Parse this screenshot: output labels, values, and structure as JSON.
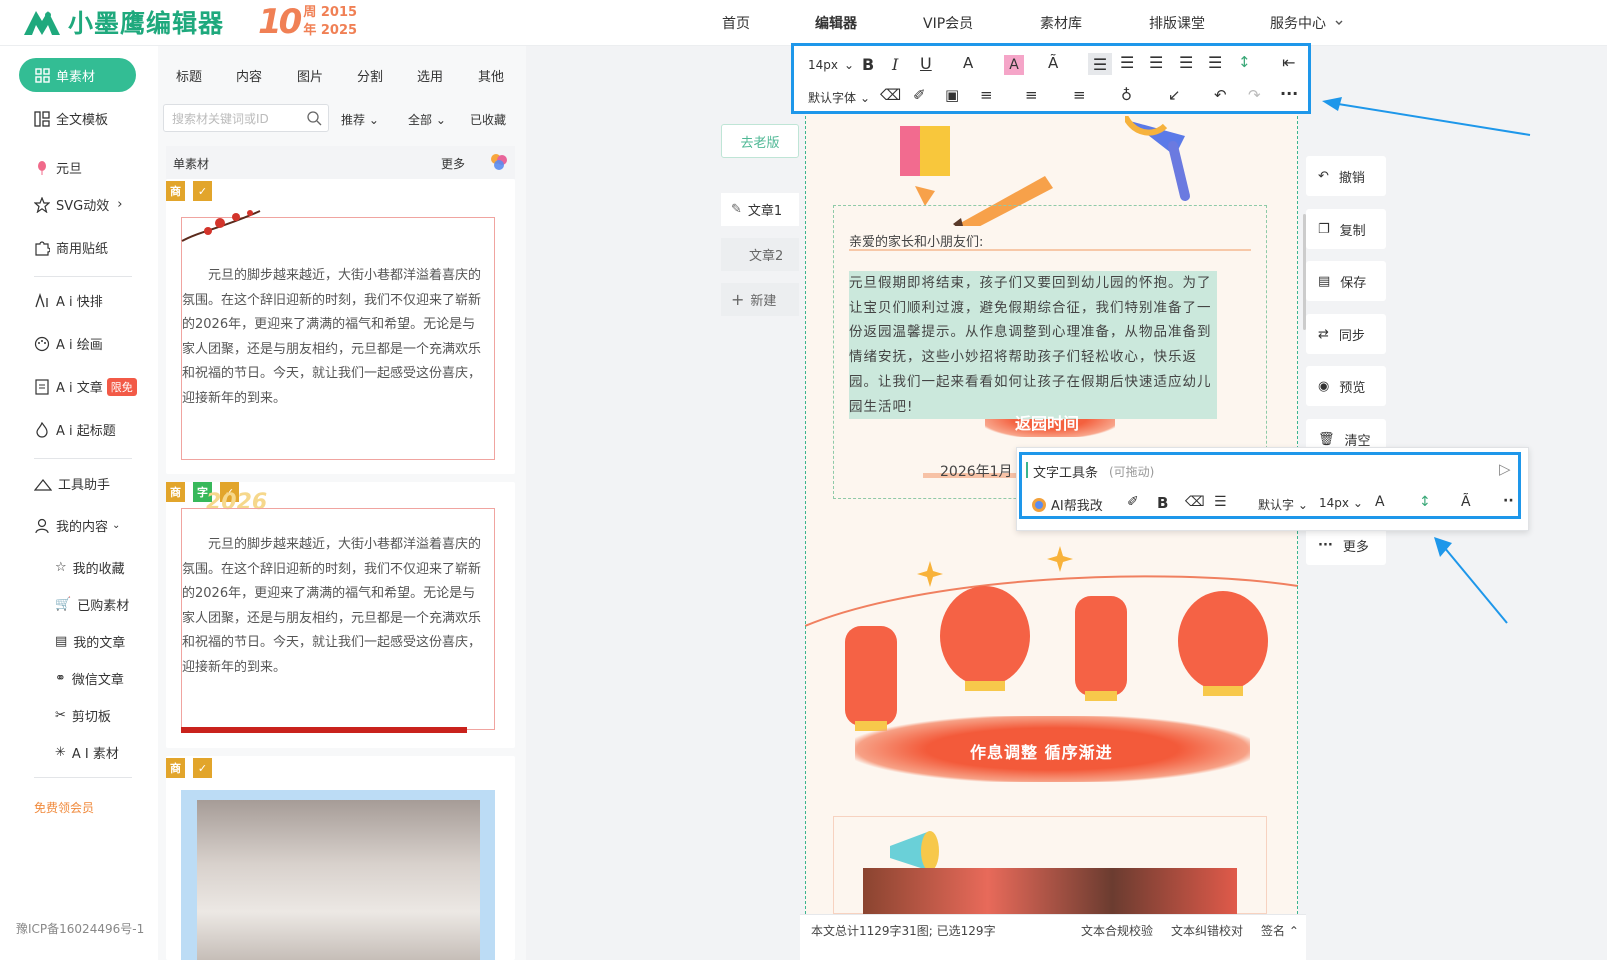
{
  "header": {
    "logo_text": "小墨鹰编辑器",
    "anniversary_number": "10",
    "anniversary_line1": "周 2015",
    "anniversary_line2": "年 2025",
    "nav": [
      "首页",
      "编辑器",
      "VIP会员",
      "素材库",
      "排版课堂",
      "服务中心"
    ]
  },
  "leftnav": {
    "active": "单素材",
    "items": [
      "全文模板",
      "元旦",
      "SVG动效",
      "商用贴纸",
      "A i 快排",
      "A i 绘画",
      "A i 文章",
      "A i 起标题",
      "工具助手",
      "我的内容"
    ],
    "ai_article_badge": "限免",
    "my_content": [
      "我的收藏",
      "已购素材",
      "我的文章",
      "微信文章",
      "剪切板",
      "A I 素材"
    ],
    "promo": "免费领会员",
    "icp": "豫ICP备16024496号-1"
  },
  "panel": {
    "tabs": [
      "标题",
      "内容",
      "图片",
      "分割",
      "选用",
      "其他"
    ],
    "search_placeholder": "搜索材关键词或ID",
    "filter1": "推荐",
    "filter2": "全部",
    "favorites": "已收藏",
    "section_title": "单素材",
    "more": "更多",
    "tags": [
      "商",
      "字"
    ],
    "card_year": "2026",
    "card_text": "元旦的脚步越来越近，大街小巷都洋溢着喜庆的氛围。在这个辞旧迎新的时刻，我们不仅迎来了崭新的2026年，更迎来了满满的福气和希望。无论是与家人团聚，还是与朋友相约，元旦都是一个充满欢乐和祝福的节日。今天，就让我们一起感受这份喜庆，迎接新年的到来。"
  },
  "toolbar": {
    "font_size": "14px",
    "font_family": "默认字体"
  },
  "workspace": {
    "old_version": "去老版",
    "doc_tabs": [
      "文章1",
      "文章2"
    ],
    "new_doc": "新建"
  },
  "canvas": {
    "greeting": "亲爱的家长和小朋友们:",
    "paragraph": "元旦假期即将结束，孩子们又要回到幼儿园的怀抱。为了让宝贝们顺利过渡，避免假期综合征，我们特别准备了一份返园温馨提示。从作息调整到心理准备，从物品准备到情绪安抚，这些小妙招将帮助孩子们轻松收心，快乐返园。让我们一起来看看如何让孩子在假期后快速适应幼儿园生活吧!",
    "return_title": "返园时间",
    "date": "2026年1月",
    "banner": "作息调整 循序渐进"
  },
  "text_toolbar": {
    "title": "文字工具条",
    "hint": "(可拖动)",
    "ai": "AI帮我改",
    "font": "默认字",
    "size": "14px"
  },
  "side_actions": [
    "撤销",
    "复制",
    "保存",
    "同步",
    "预览",
    "清空",
    "更多"
  ],
  "status": {
    "count": "本文总计1129字31图; 已选129字",
    "compliance": "文本合规校验",
    "proofread": "文本纠错校对",
    "signature": "签名"
  },
  "colors": {
    "brand": "#33bd94",
    "highlight_box": "#1e97ea",
    "accent": "#f08055"
  }
}
